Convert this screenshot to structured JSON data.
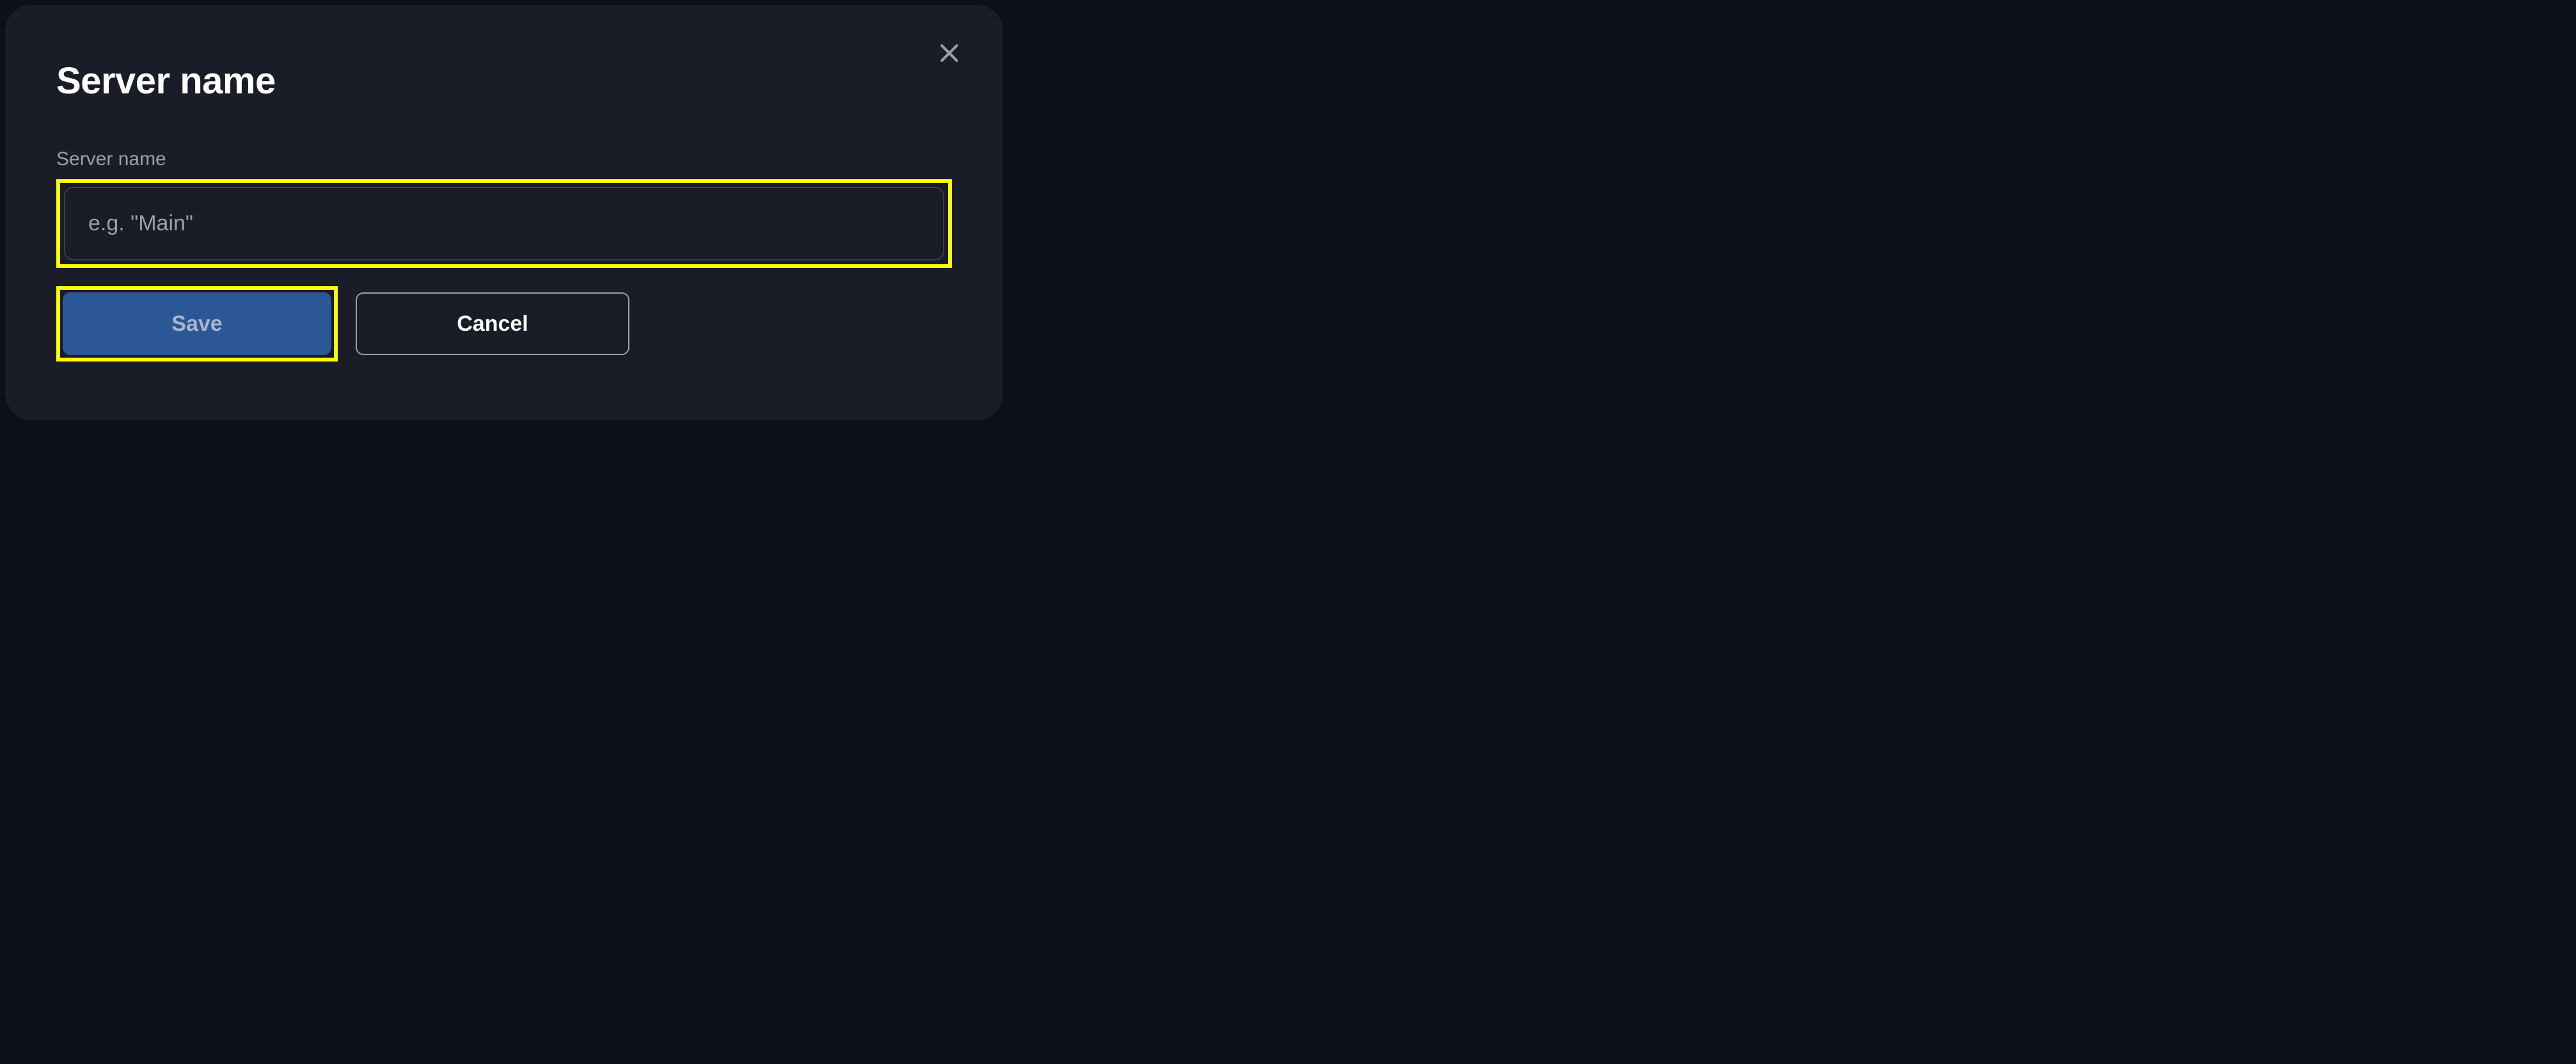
{
  "modal": {
    "title": "Server name",
    "field_label": "Server name",
    "input_placeholder": "e.g. \"Main\"",
    "input_value": "",
    "save_label": "Save",
    "cancel_label": "Cancel"
  }
}
